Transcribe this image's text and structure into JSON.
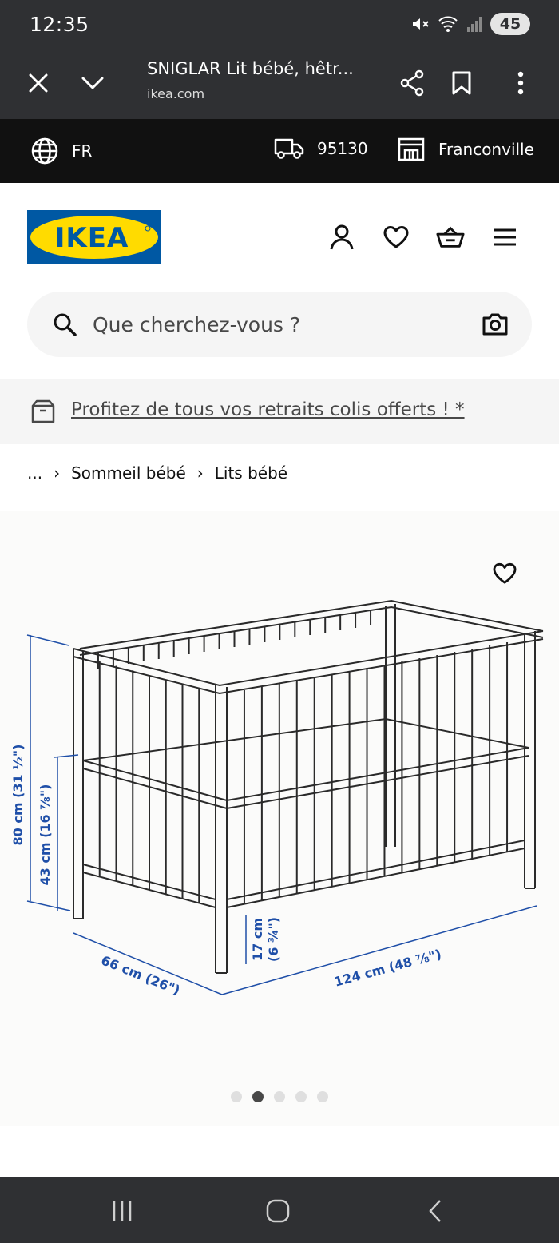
{
  "status_bar": {
    "time": "12:35",
    "battery": "45"
  },
  "browser": {
    "page_title": "SNIGLAR Lit bébé, hêtr...",
    "domain": "ikea.com"
  },
  "store_bar": {
    "language": "FR",
    "postcode": "95130",
    "store": "Franconville"
  },
  "header": {
    "logo_text": "IKEA"
  },
  "search": {
    "placeholder": "Que cherchez-vous ?"
  },
  "promo": {
    "text": "Profitez de tous vos retraits colis offerts ! *"
  },
  "breadcrumb": {
    "ellipsis": "...",
    "items": [
      "Sommeil bébé",
      "Lits bébé"
    ]
  },
  "product_image": {
    "dimensions": {
      "height_total": "80 cm (31 ½\")",
      "height_mattress": "43 cm (16 ⅞\")",
      "clearance": "17 cm",
      "clearance_in": "(6 ¾\")",
      "width": "66 cm (26\")",
      "length": "124 cm (48 ⅞\")"
    }
  },
  "gallery": {
    "total_images": 5,
    "active_index": 1
  },
  "colors": {
    "ikea_blue": "#0058a3",
    "ikea_yellow": "#ffdb00",
    "dimension_blue": "#1f4fa8",
    "system_bar": "#2f3033"
  }
}
